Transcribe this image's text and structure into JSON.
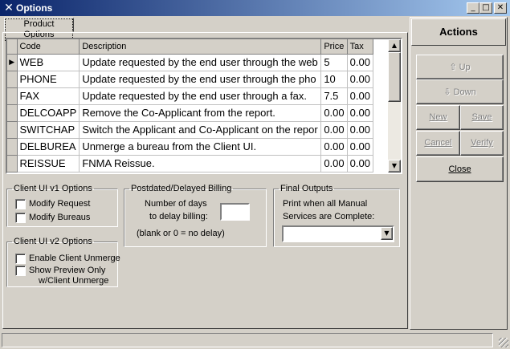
{
  "window": {
    "title": "Options",
    "app_icon": "x-logo-icon"
  },
  "tabs": [
    {
      "label": "Product Options"
    }
  ],
  "grid": {
    "columns": [
      "Code",
      "Description",
      "Price",
      "Tax"
    ],
    "rows": [
      {
        "code": "WEB",
        "description": "Update requested by the end user through the web",
        "price": "5",
        "tax": "0.00",
        "current": true
      },
      {
        "code": "PHONE",
        "description": "Update requested by the end user through the pho",
        "price": "10",
        "tax": "0.00"
      },
      {
        "code": "FAX",
        "description": "Update requested by the end user through a fax.",
        "price": "7.5",
        "tax": "0.00"
      },
      {
        "code": "DELCOAPP",
        "description": "Remove the Co-Applicant from the report.",
        "price": "0.00",
        "tax": "0.00"
      },
      {
        "code": "SWITCHAP",
        "description": "Switch the Applicant and Co-Applicant on the repor",
        "price": "0.00",
        "tax": "0.00"
      },
      {
        "code": "DELBUREA",
        "description": "Unmerge a bureau from the Client UI.",
        "price": "0.00",
        "tax": "0.00"
      },
      {
        "code": "REISSUE",
        "description": "FNMA Reissue.",
        "price": "0.00",
        "tax": "0.00"
      }
    ]
  },
  "client_ui_v1": {
    "legend": "Client UI v1 Options",
    "modify_request": {
      "label": "Modify Request",
      "checked": false
    },
    "modify_bureaus": {
      "label": "Modify Bureaus",
      "checked": false
    }
  },
  "client_ui_v2": {
    "legend": "Client UI v2 Options",
    "enable_unmerge": {
      "label": "Enable Client Unmerge",
      "checked": false
    },
    "show_preview": {
      "label_line1": "Show Preview Only",
      "label_line2": "w/Client Unmerge",
      "checked": false
    }
  },
  "billing": {
    "legend": "Postdated/Delayed Billing",
    "days_label_line1": "Number of days",
    "days_label_line2": "to delay billing:",
    "days_value": "",
    "hint": "(blank or 0 = no delay)"
  },
  "final_outputs": {
    "legend": "Final Outputs",
    "label_line1": "Print when all Manual",
    "label_line2": "Services are Complete:",
    "selected": ""
  },
  "actions": {
    "header": "Actions",
    "up": {
      "label": "Up",
      "enabled": false,
      "icon": "arrow-up-icon"
    },
    "down": {
      "label": "Down",
      "enabled": false,
      "icon": "arrow-down-icon"
    },
    "new": {
      "label": "New",
      "enabled": false
    },
    "save": {
      "label": "Save",
      "enabled": false
    },
    "cancel": {
      "label": "Cancel",
      "enabled": false
    },
    "verify": {
      "label": "Verify",
      "enabled": false
    },
    "close": {
      "label": "Close",
      "enabled": true
    }
  }
}
